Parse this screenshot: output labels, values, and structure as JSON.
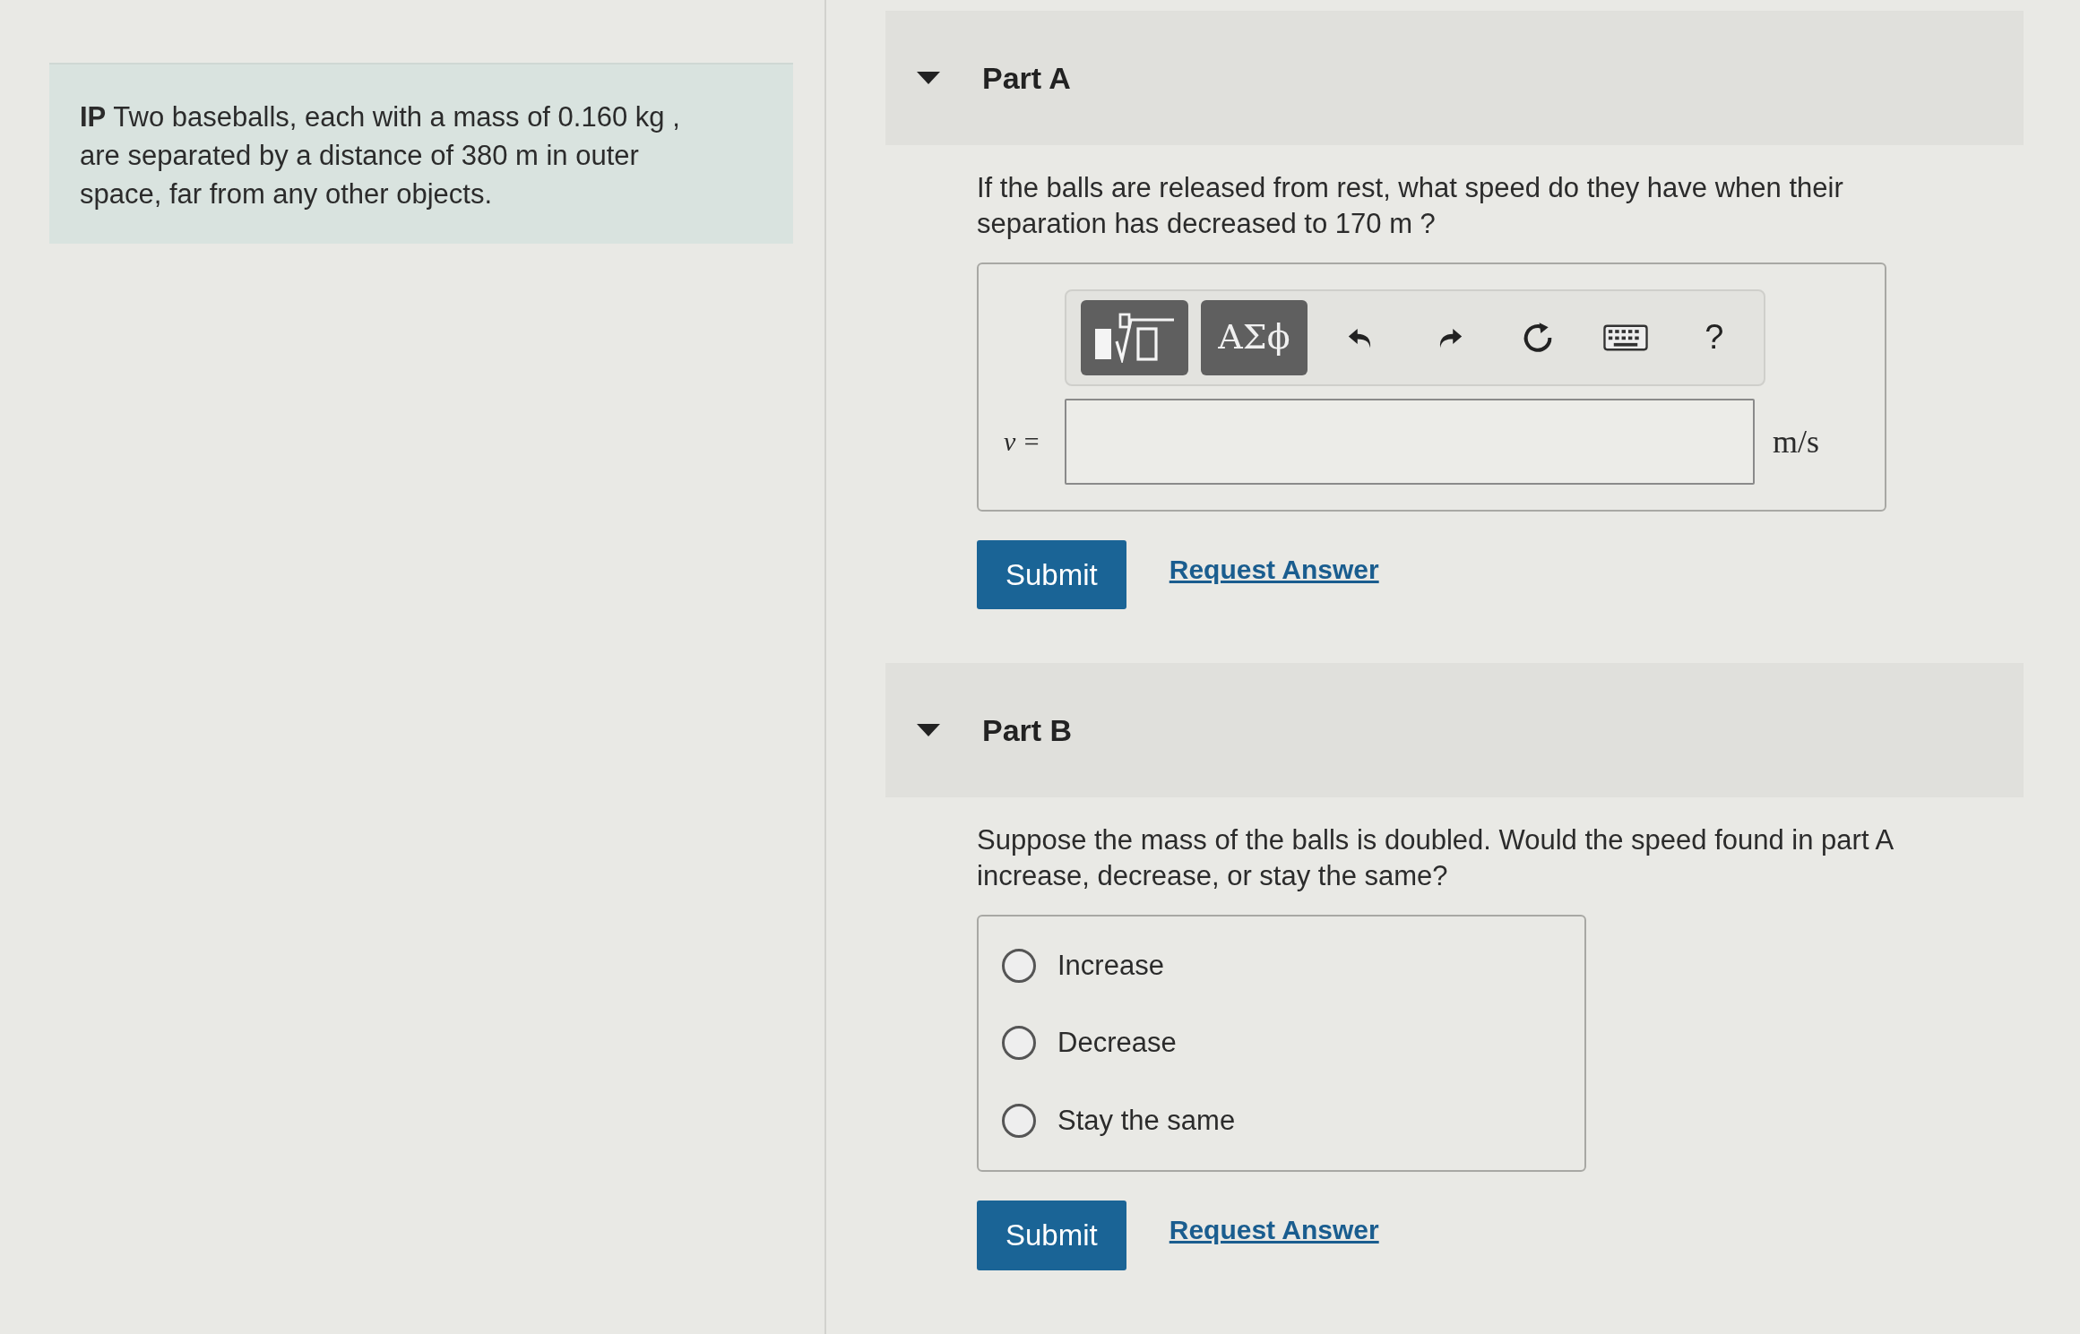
{
  "intro": "**IP** Two baseballs, each with a mass of 0.160 kg , are separated by a distance of 380 m in outer space, far from any other objects.",
  "parts": [
    {
      "title": "Part A",
      "expanded": true,
      "kind": "numeric",
      "question": "If the balls are released from rest, what speed do they have when their separation has decreased to 170 m ?",
      "toolbar": [
        {
          "kind": "templates"
        },
        {
          "kind": "greek",
          "label": "ΑΣϕ"
        },
        {
          "kind": "undo"
        },
        {
          "kind": "redo"
        },
        {
          "kind": "reset"
        },
        {
          "kind": "keyboard"
        },
        {
          "kind": "help",
          "label": "?"
        }
      ],
      "variable": "v =",
      "unit": "m/s",
      "submit": "Submit",
      "request": "Request Answer"
    },
    {
      "title": "Part B",
      "expanded": true,
      "kind": "choice",
      "question": "Suppose the mass of the balls is doubled. Would the speed found in part A increase, decrease, or stay the same?",
      "options": [
        {
          "label": "Increase",
          "selected": false
        },
        {
          "label": "Decrease",
          "selected": false
        },
        {
          "label": "Stay the same",
          "selected": false
        }
      ],
      "submit": "Submit",
      "request": "Request Answer"
    }
  ]
}
